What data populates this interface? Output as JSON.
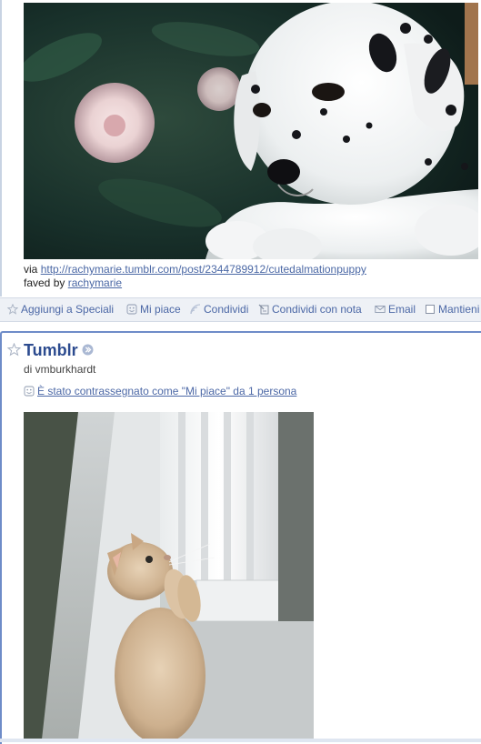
{
  "previous_item": {
    "via_prefix": "via",
    "via_link": "http://rachymarie.tumblr.com/post/2344789912/cutedalmationpuppy",
    "faved_prefix": "faved by",
    "faved_link": "rachymarie"
  },
  "action_bar": {
    "star": "Aggiungi a Speciali",
    "like": "Mi piace",
    "share": "Condividi",
    "share_note": "Condividi con nota",
    "email": "Email",
    "keep": "Mantieni"
  },
  "current_item": {
    "source_title": "Tumblr",
    "author": "di vmburkhardt",
    "likes_text": "È stato contrassegnato come \"Mi piace\" da 1 persona"
  },
  "colors": {
    "link": "#4c68a6",
    "title": "#2c4b8f",
    "selected_border": "#6e8cc8",
    "action_bar_bg": "#eef1f6"
  },
  "icons": [
    "star-icon",
    "smiley-icon",
    "share-icon",
    "note-icon",
    "email-icon",
    "checkbox-icon",
    "arrow-right-icon"
  ]
}
